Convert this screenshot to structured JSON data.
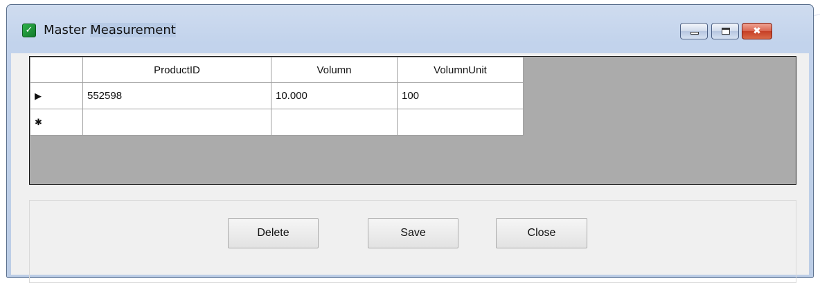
{
  "window": {
    "title_part1": "Master",
    "title_part2": "Measurement",
    "minimize_glyph": "",
    "maximize_glyph": "",
    "close_glyph": "✖"
  },
  "grid": {
    "columns": [
      "ProductID",
      "Volumn",
      "VolumnUnit"
    ],
    "rows": [
      {
        "indicator": "▶",
        "cells": [
          "552598",
          "10.000",
          "100"
        ],
        "selected_cell": 0
      },
      {
        "indicator": "✱",
        "cells": [
          "",
          "",
          ""
        ]
      }
    ]
  },
  "buttons": {
    "delete": "Delete",
    "save": "Save",
    "close": "Close"
  },
  "colors": {
    "selection": "#3399ff",
    "grid_background": "#ababab",
    "close_button": "#c63f26"
  }
}
